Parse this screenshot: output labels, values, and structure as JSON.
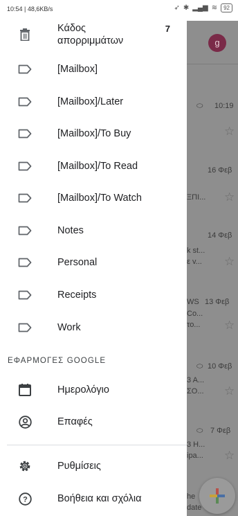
{
  "status_bar": {
    "left": "10:54 | 48,6KB/s",
    "battery": "92"
  },
  "background": {
    "avatar_letter": "g",
    "rows": [
      {
        "meta": "10:19",
        "top": ""
      },
      {
        "meta": "16 Φεβ",
        "top": "ΞΠΙ..."
      },
      {
        "meta": "14 Φεβ",
        "top": "k st...",
        "bottom": "ε v..."
      },
      {
        "meta": "13 Φεβ",
        "top": "Co...",
        "bottom": "το...",
        "prefix": "WS"
      },
      {
        "meta": "10 Φεβ",
        "top": "3 A...",
        "bottom": "ΣO..."
      },
      {
        "meta": "7 Φεβ",
        "top": "3 H...",
        "bottom": "ipa..."
      }
    ],
    "tail_top": "he",
    "tail_bottom": "date"
  },
  "drawer": {
    "trash": {
      "label_line1": "Κάδος",
      "label_line2": "απορριμμάτων",
      "count": "7"
    },
    "labels": [
      "[Mailbox]",
      "[Mailbox]/Later",
      "[Mailbox]/To Buy",
      "[Mailbox]/To Read",
      "[Mailbox]/To Watch",
      "Notes",
      "Personal",
      "Receipts",
      "Work"
    ],
    "google_apps_header": "ΕΦΑΡΜΟΓΕΣ GOOGLE",
    "calendar": "Ημερολόγιο",
    "contacts": "Επαφές",
    "settings": "Ρυθμίσεις",
    "help": "Βοήθεια και σχόλια"
  }
}
